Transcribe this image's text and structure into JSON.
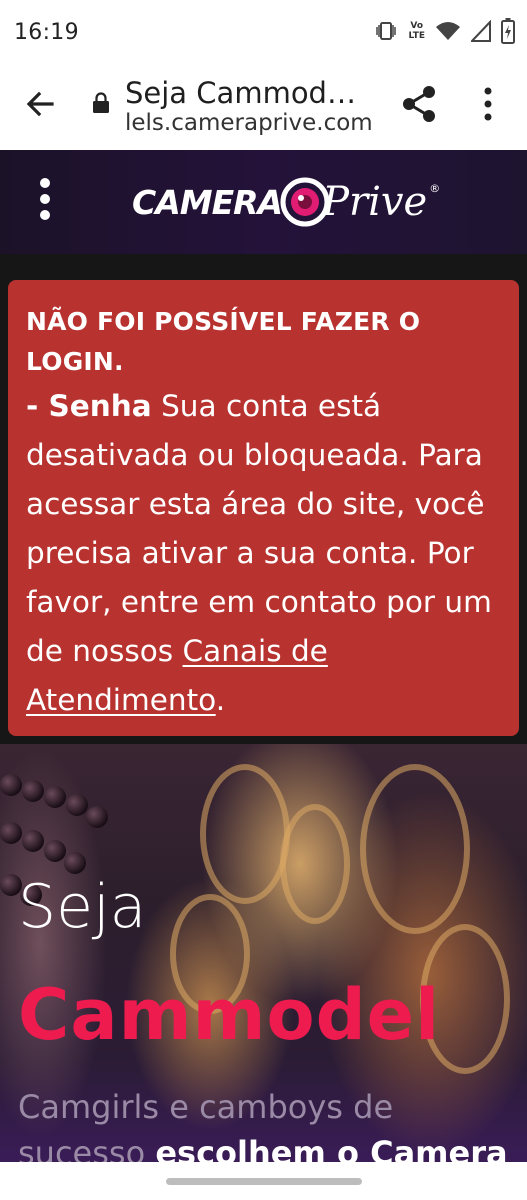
{
  "status_bar": {
    "time": "16:19",
    "lte_top": "Vo",
    "lte_bottom": "LTE",
    "icons": [
      "vibrate-icon",
      "volte-icon",
      "wifi-icon",
      "signal-icon",
      "battery-icon"
    ]
  },
  "browser": {
    "title": "Seja Cammod…",
    "url": "lels.cameraprive.com",
    "icons": [
      "back-arrow-icon",
      "lock-icon",
      "share-icon",
      "more-vert-icon"
    ]
  },
  "site_header": {
    "logo_camera": "CAMERA",
    "logo_prive": "Prive",
    "logo_reg": "®",
    "icons": [
      "kebab-menu-icon"
    ]
  },
  "alert": {
    "title": "NÃO FOI POSSÍVEL FAZER O LOGIN.",
    "field": "- Senha",
    "message": " Sua conta está desativada ou bloqueada. Para acessar esta área do site, você precisa ativar a sua conta. Por favor, entre em contato por um de nossos ",
    "link": "Canais de Atendimento",
    "end": "."
  },
  "hero": {
    "title_line1": "Seja",
    "title_line2": "Cammodel",
    "subtitle_plain": "Camgirls e camboys de sucesso ",
    "subtitle_bold": "escolhem o Camera"
  },
  "colors": {
    "alert_bg": "#b8322f",
    "header_bg": "#24123a",
    "accent_pink": "#ee1b4f"
  }
}
